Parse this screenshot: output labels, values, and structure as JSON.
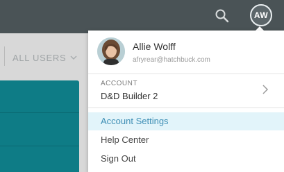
{
  "header": {
    "search_icon": "search-icon",
    "avatar_initials": "AW"
  },
  "filter": {
    "label": "ALL USERS"
  },
  "user_menu": {
    "name": "Allie Wolff",
    "email": "afryrear@hatchbuck.com",
    "account_label": "ACCOUNT",
    "account_name": "D&D Builder 2",
    "items": [
      {
        "label": "Account Settings",
        "active": true
      },
      {
        "label": "Help Center",
        "active": false
      },
      {
        "label": "Sign Out",
        "active": false
      }
    ]
  },
  "colors": {
    "topbar": "#4a5356",
    "teal": "#0e7c86",
    "highlight": "#e2f4fa",
    "highlight_text": "#3f8fb5"
  }
}
